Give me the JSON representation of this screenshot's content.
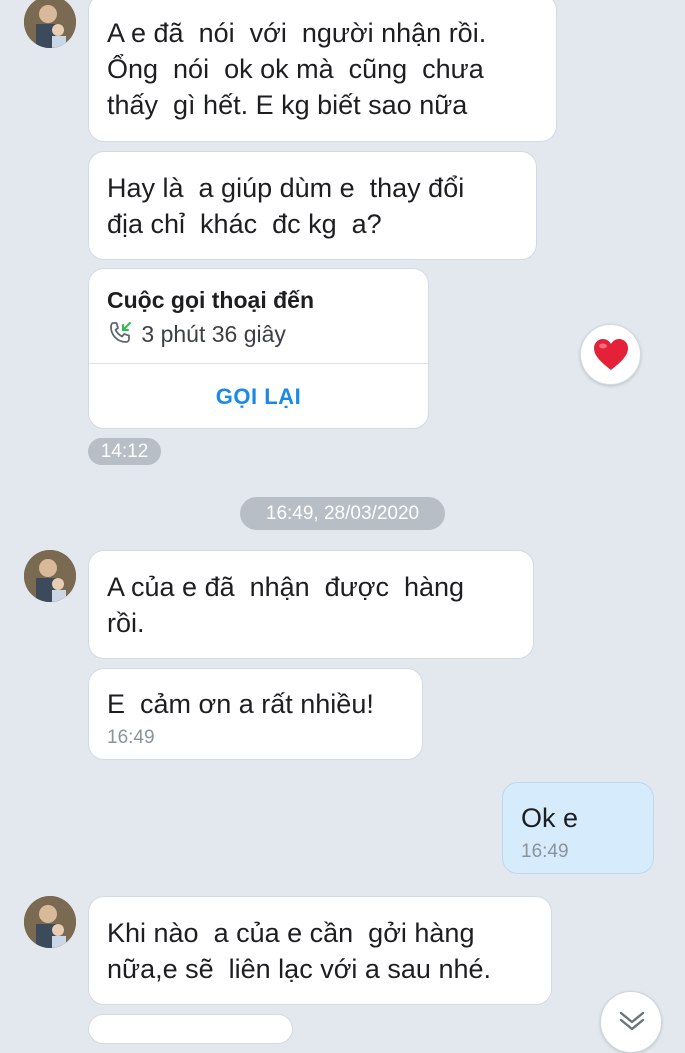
{
  "messages": [
    {
      "lines": [
        "A e đã  nói  với  người nhận rồi.",
        "Ổng  nói  ok ok mà  cũng  chưa",
        "thấy  gì hết. E kg biết sao nữa"
      ]
    },
    {
      "lines": [
        "Hay là  a giúp dùm e  thay đổi",
        "địa chỉ  khác  đc kg  a?"
      ]
    },
    {
      "lines": [
        "A của e đã  nhận  được  hàng",
        "rồi."
      ]
    },
    {
      "lines": [
        "E  cảm ơn a rất nhiều!"
      ],
      "time": "16:49"
    },
    {
      "lines": [
        "Ok e"
      ],
      "time": "16:49"
    },
    {
      "lines": [
        "Khi nào  a của e cần  gởi hàng",
        "nữa,e sẽ  liên lạc với a sau nhé."
      ]
    }
  ],
  "call": {
    "title": "Cuộc gọi thoại đến",
    "duration": "3 phút 36 giây",
    "action": "GỌI LẠI",
    "reaction_icon": "heart-icon",
    "time": "14:12"
  },
  "date_separator": "16:49, 28/03/2020",
  "colors": {
    "background": "#e3e8ef",
    "incoming_bubble": "#ffffff",
    "outgoing_bubble": "#d6ecfc",
    "accent": "#1a8ae8",
    "heart": "#e5213a"
  },
  "icons": {
    "call": "incoming-call-icon",
    "scroll": "chevron-down-icon",
    "avatar": "avatar"
  }
}
